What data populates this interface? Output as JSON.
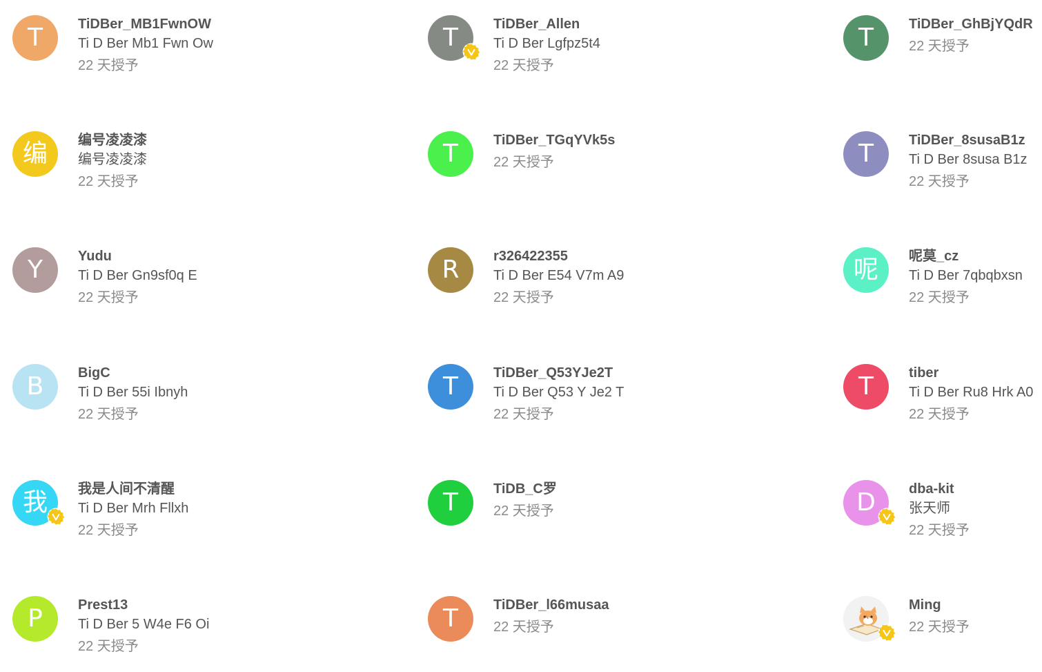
{
  "granted_suffix": "22 天授予",
  "colors": {
    "badge": "#f5c518",
    "username": "#555555",
    "granted": "#8a8a8a"
  },
  "users": [
    {
      "username": "TiDBer_MB1FwnOW",
      "display_name": "Ti D Ber Mb1 Fwn Ow",
      "initial": "T",
      "avatar_color": "#f0a868",
      "verified": false,
      "granted": "22 天授予"
    },
    {
      "username": "TiDBer_Allen",
      "display_name": "Ti D Ber Lgfpz5t4",
      "initial": "T",
      "avatar_color": "#868a84",
      "verified": true,
      "granted": "22 天授予"
    },
    {
      "username": "TiDBer_GhBjYQdR",
      "display_name": "",
      "initial": "T",
      "avatar_color": "#55936b",
      "verified": false,
      "granted": "22 天授予"
    },
    {
      "username": "编号凌凌漆",
      "display_name": "编号凌凌漆",
      "initial": "编",
      "avatar_color": "#f4c91e",
      "verified": false,
      "granted": "22 天授予"
    },
    {
      "username": "TiDBer_TGqYVk5s",
      "display_name": "",
      "initial": "T",
      "avatar_color": "#4cf04c",
      "verified": false,
      "granted": "22 天授予"
    },
    {
      "username": "TiDBer_8susaB1z",
      "display_name": "Ti D Ber 8susa B1z",
      "initial": "T",
      "avatar_color": "#8e8dc0",
      "verified": false,
      "granted": "22 天授予"
    },
    {
      "username": "Yudu",
      "display_name": "Ti D Ber Gn9sf0q E",
      "initial": "Y",
      "avatar_color": "#b29c9c",
      "verified": false,
      "granted": "22 天授予"
    },
    {
      "username": "r326422355",
      "display_name": "Ti D Ber E54 V7m A9",
      "initial": "R",
      "avatar_color": "#a68a43",
      "verified": false,
      "granted": "22 天授予"
    },
    {
      "username": "呢莫_cz",
      "display_name": "Ti D Ber 7qbqbxsn",
      "initial": "呢",
      "avatar_color": "#5cf0c7",
      "verified": false,
      "granted": "22 天授予"
    },
    {
      "username": "BigC",
      "display_name": "Ti D Ber 55i Ibnyh",
      "initial": "B",
      "avatar_color": "#b8e3f2",
      "verified": false,
      "granted": "22 天授予"
    },
    {
      "username": "TiDBer_Q53YJe2T",
      "display_name": "Ti D Ber Q53 Y Je2 T",
      "initial": "T",
      "avatar_color": "#3d8fdc",
      "verified": false,
      "granted": "22 天授予"
    },
    {
      "username": "tiber",
      "display_name": "Ti D Ber Ru8 Hrk A0",
      "initial": "T",
      "avatar_color": "#ee4b66",
      "verified": false,
      "granted": "22 天授予"
    },
    {
      "username": "我是人间不清醒",
      "display_name": "Ti D Ber Mrh Fllxh",
      "initial": "我",
      "avatar_color": "#35d7f4",
      "verified": true,
      "granted": "22 天授予"
    },
    {
      "username": "TiDB_C罗",
      "display_name": "",
      "initial": "T",
      "avatar_color": "#1fcf3e",
      "verified": false,
      "granted": "22 天授予"
    },
    {
      "username": "dba-kit",
      "display_name": "张天师",
      "initial": "D",
      "avatar_color": "#e892ea",
      "verified": true,
      "granted": "22 天授予"
    },
    {
      "username": "Prest13",
      "display_name": "Ti D Ber 5 W4e F6 Oi",
      "initial": "P",
      "avatar_color": "#b4e92c",
      "verified": false,
      "granted": "22 天授予"
    },
    {
      "username": "TiDBer_l66musaa",
      "display_name": "",
      "initial": "T",
      "avatar_color": "#ec8b5a",
      "verified": false,
      "granted": "22 天授予"
    },
    {
      "username": "Ming",
      "display_name": "",
      "initial": "",
      "avatar_color": "#eeeeee",
      "avatar_image": "cat-reading-avatar",
      "verified": true,
      "granted": "22 天授予"
    }
  ]
}
